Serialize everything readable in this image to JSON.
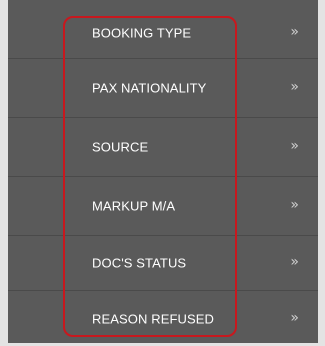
{
  "menu": {
    "items": [
      {
        "label": "BOOKING TYPE",
        "arrow": "»"
      },
      {
        "label": "PAX NATIONALITY",
        "arrow": "»"
      },
      {
        "label": "SOURCE",
        "arrow": "»"
      },
      {
        "label": "MARKUP M/A",
        "arrow": "»"
      },
      {
        "label": "DOC'S STATUS",
        "arrow": "»"
      },
      {
        "label": "REASON REFUSED",
        "arrow": "»"
      }
    ]
  },
  "colors": {
    "panel_background": "#5a5a5a",
    "divider": "#4a4a4a",
    "outer_background": "#e3e3e3",
    "text": "#ffffff",
    "highlight_border": "#c8181e"
  }
}
